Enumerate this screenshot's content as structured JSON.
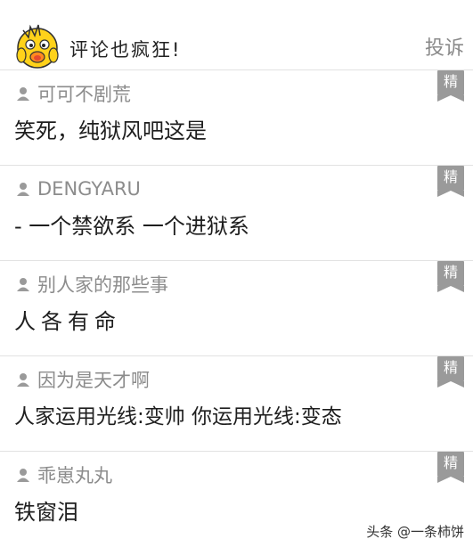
{
  "header": {
    "title": "评论也疯狂!",
    "report_label": "投诉"
  },
  "badge_label": "精",
  "comments": [
    {
      "user": "可可不剧荒",
      "text": "笑死，纯狱风吧这是"
    },
    {
      "user": "DENGYARU",
      "text": "- 一个禁欲系 一个进狱系"
    },
    {
      "user": "别人家的那些事",
      "text": "人各有命"
    },
    {
      "user": "因为是天才啊",
      "text": "人家运用光线:变帅 你运用光线:变态"
    },
    {
      "user": "乖崽丸丸",
      "text": "铁窗泪"
    }
  ],
  "watermark": "头条 @一条柿饼",
  "colors": {
    "badge": "#9a9a9a",
    "username": "#8c8c8c",
    "report": "#8a8a8a",
    "divider": "#e2e2e2"
  }
}
